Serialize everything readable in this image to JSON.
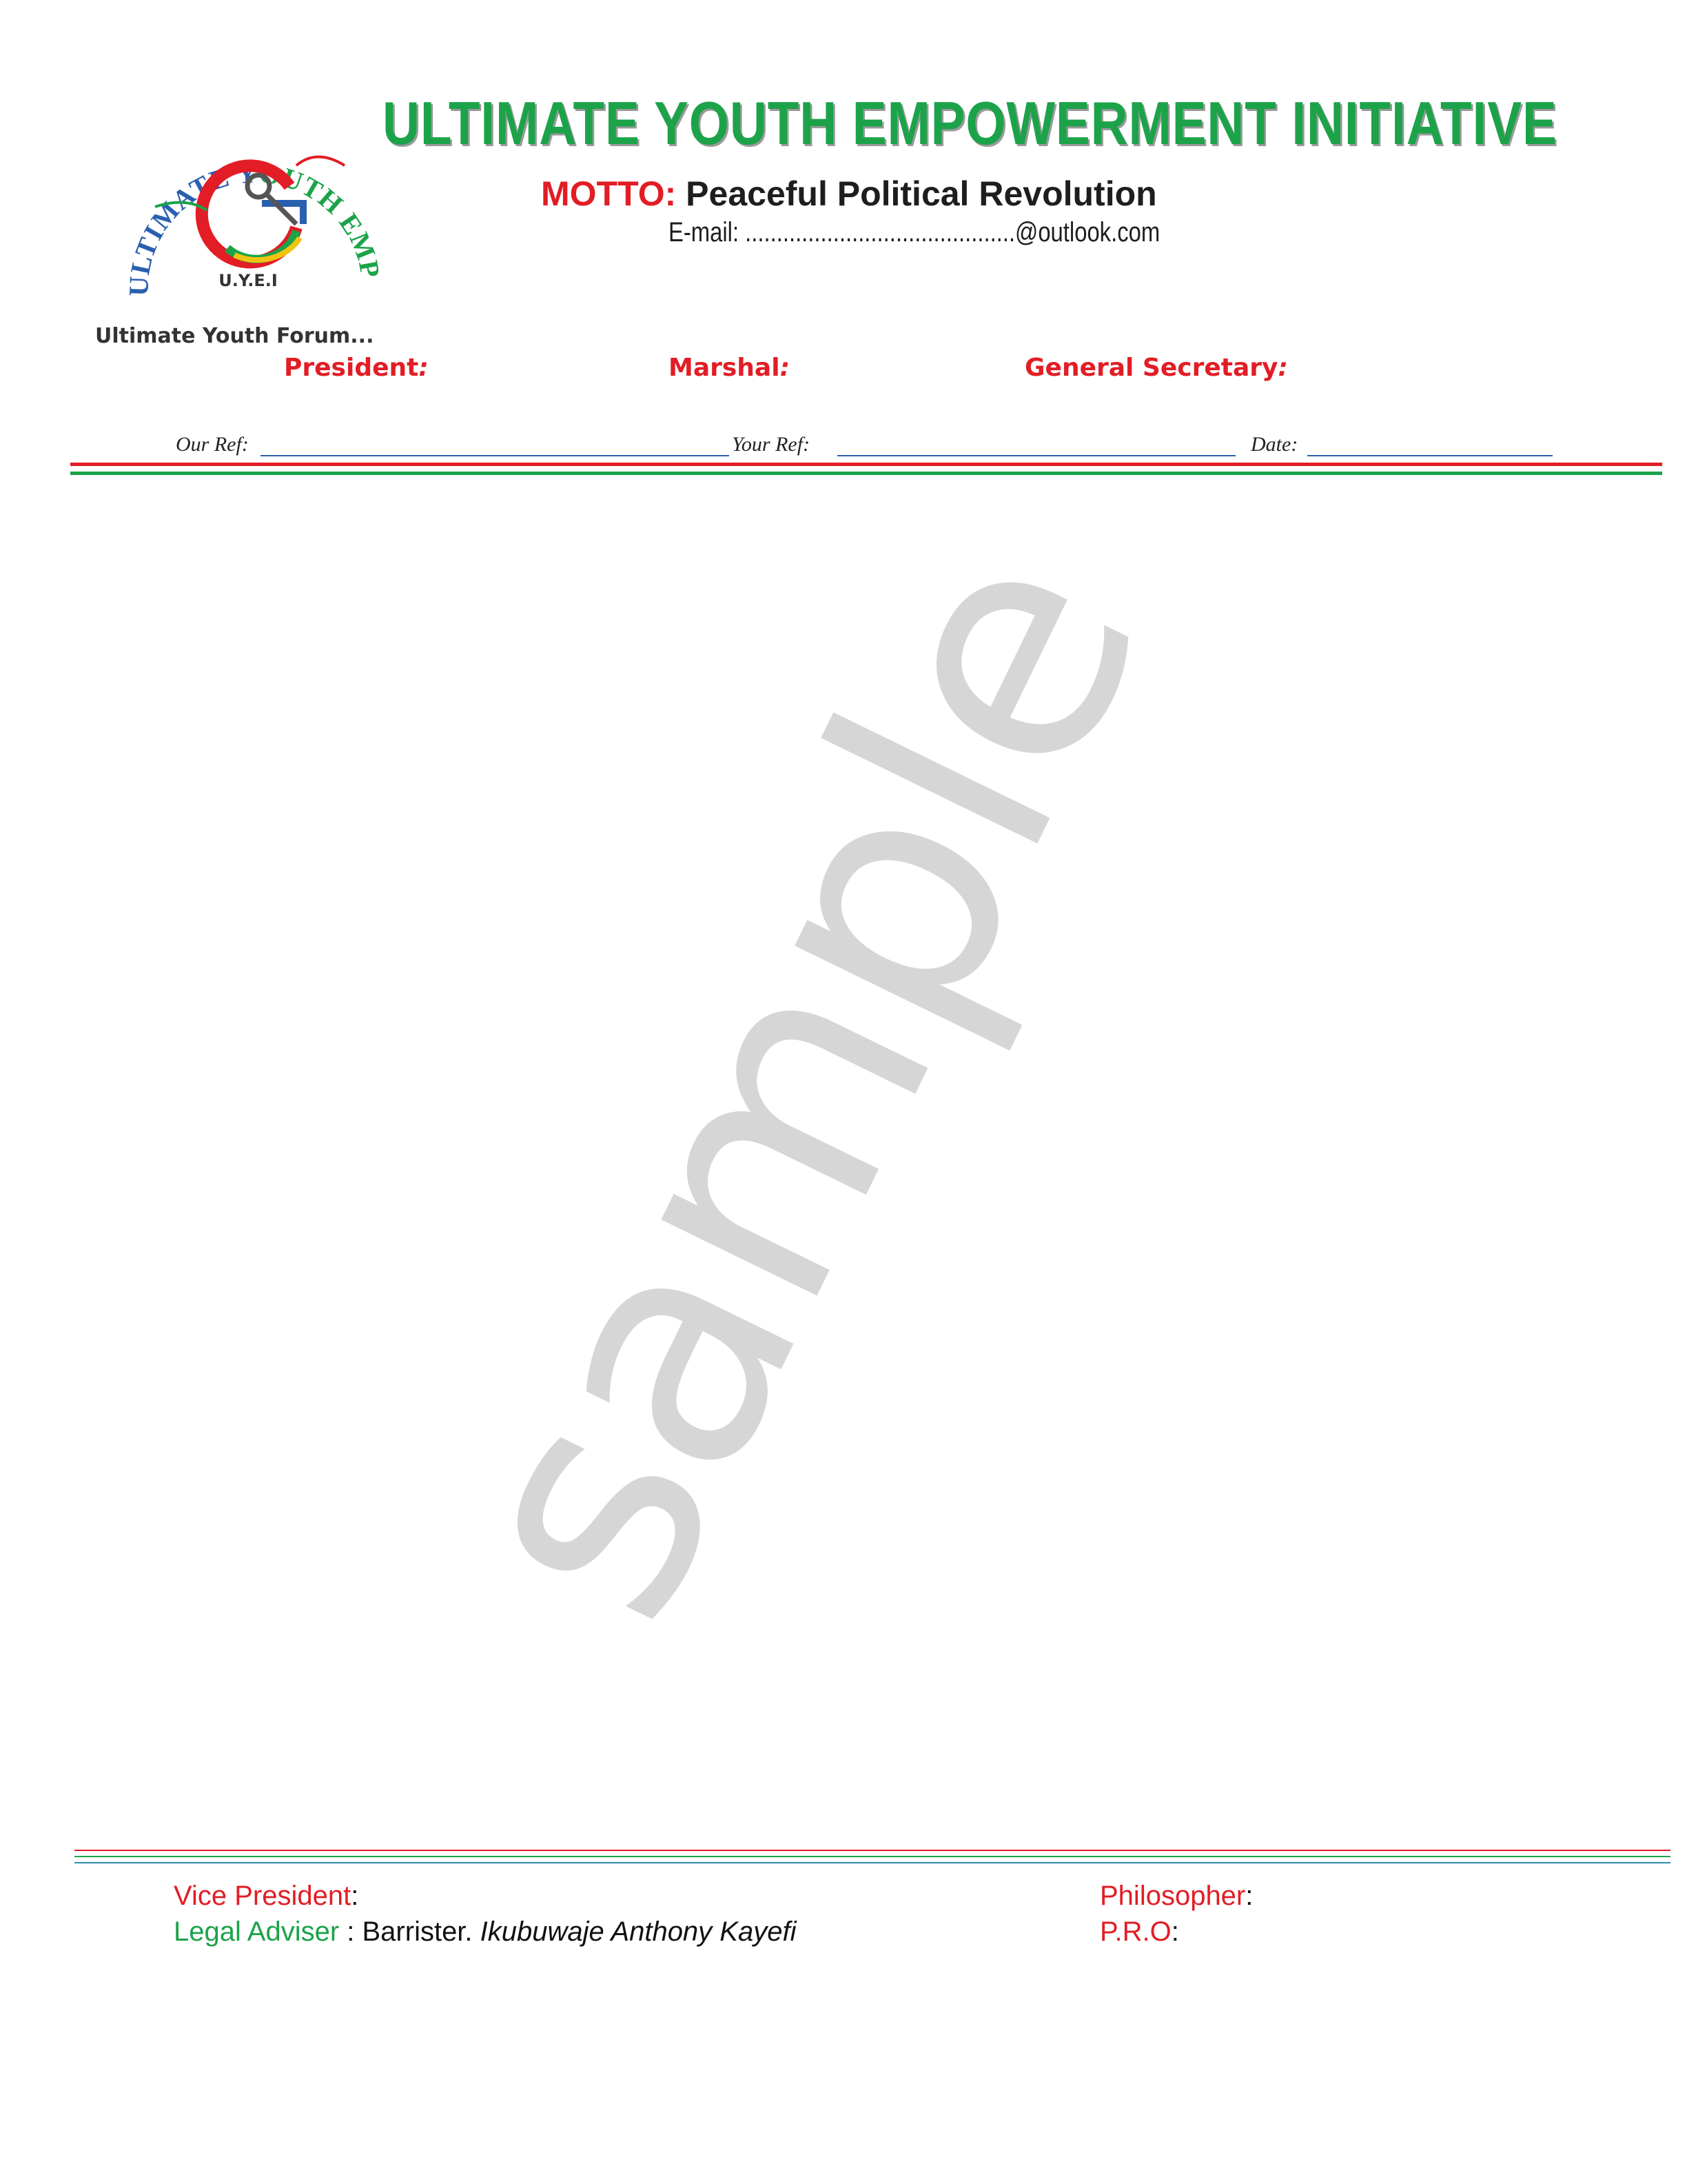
{
  "header": {
    "org_name": "ULTIMATE YOUTH EMPOWERMENT INITIATIVE",
    "motto_label": "MOTTO:",
    "motto_text": "Peaceful Political Revolution",
    "email": "E-mail: ...........................................@outlook.com",
    "logo_ring_text": "ULTIMATE YOUTH EMPOWERMENT INITIATIVE",
    "logo_initials": "U.Y.E.I",
    "forum_text": "Ultimate Youth Forum..."
  },
  "officers": {
    "president": "President",
    "marshal": "Marshal",
    "general_secretary": "General Secretary",
    "colon": ":"
  },
  "refs": {
    "our_ref": "Our Ref:",
    "your_ref": "Your Ref:",
    "date": "Date:"
  },
  "watermark": "sample",
  "footer": {
    "vice_president": "Vice President",
    "legal_adviser": "Legal Adviser",
    "legal_adviser_title": " : Barrister. ",
    "legal_adviser_name": "Ikubuwaje Anthony Kayefi",
    "philosopher": "Philosopher",
    "pro": "P.R.O",
    "colon": ":"
  },
  "colors": {
    "green": "#1ca34a",
    "red": "#e21d25",
    "blue": "#2a5fb0"
  }
}
